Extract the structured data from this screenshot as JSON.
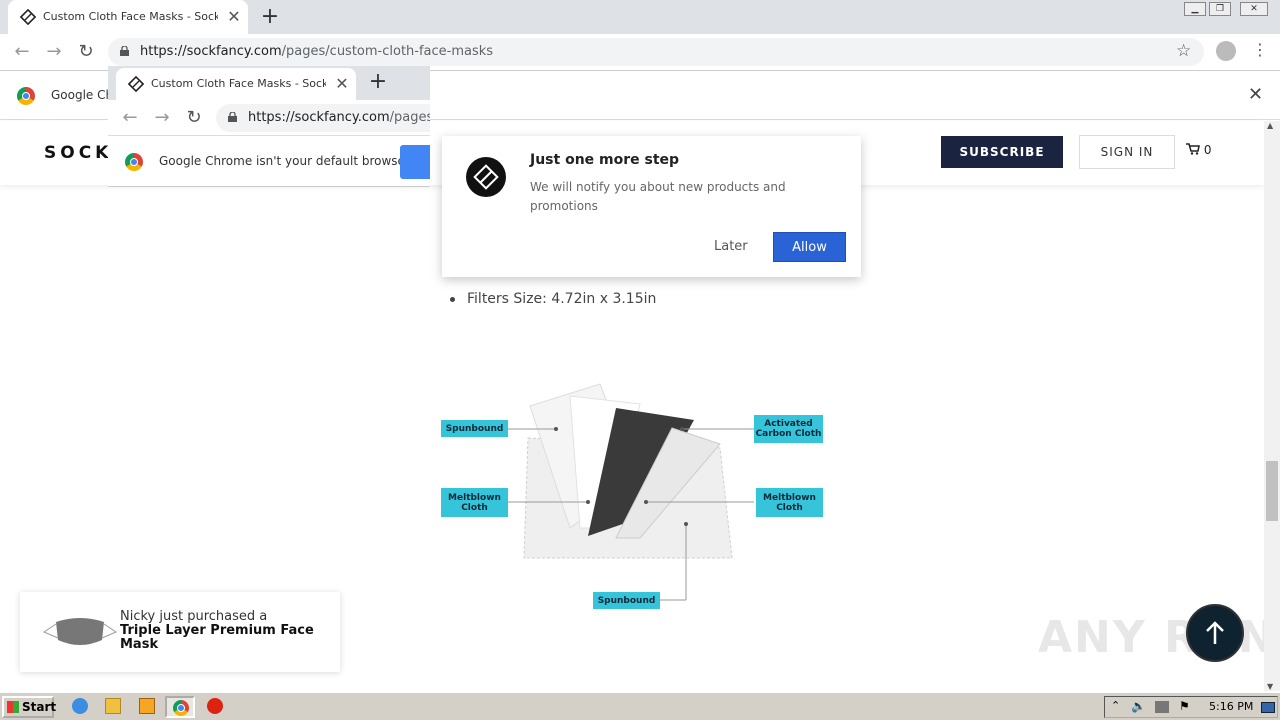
{
  "browser": {
    "tab_title": "Custom Cloth Face Masks - Sock Fan",
    "url_host": "https://sockfancy.com",
    "url_path": "/pages/custom-cloth-face-masks",
    "infobar_text": "Google Chrome isn't your default browser",
    "infobar_truncated": "Google Ch"
  },
  "overlay": {
    "tab_title": "Custom Cloth Face Masks - Sock Fan",
    "url_host": "https://sockfancy.com",
    "url_path": "/pages",
    "infobar_text": "Google Chrome isn't your default browser"
  },
  "site": {
    "brand": "SOCK",
    "subscribe_label": "SUBSCRIBE",
    "signin_label": "SIGN IN",
    "cart_count": "0"
  },
  "content": {
    "bullet": "Filters Size: 4.72in x 3.15in",
    "labels": {
      "spunbound_top": "Spunbound",
      "activated_carbon": "Activated Carbon Cloth",
      "meltblown_left": "Meltblown Cloth",
      "meltblown_right": "Meltblown Cloth",
      "spunbound_bottom": "Spunbound"
    }
  },
  "popup": {
    "title": "Just one more step",
    "message": "We will notify you about new products and promotions",
    "later_label": "Later",
    "allow_label": "Allow"
  },
  "toast": {
    "line1": "Nicky just purchased a",
    "product": "Triple Layer Premium Face Mask"
  },
  "watermark": "ANY RUN",
  "taskbar": {
    "start_label": "Start",
    "clock": "5:16 PM"
  },
  "colors": {
    "subscribe_bg": "#1a2440",
    "allow_bg": "#2a63d6",
    "label_bg": "#36c4da"
  }
}
